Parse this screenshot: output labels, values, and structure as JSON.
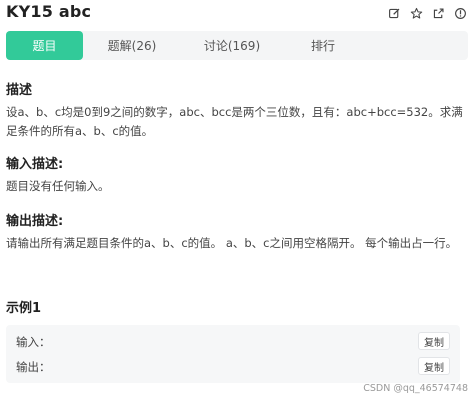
{
  "header": {
    "title": "KY15  abc",
    "icons": [
      "edit-icon",
      "star-icon",
      "share-icon",
      "report-icon"
    ]
  },
  "tabs": [
    {
      "label": "题目",
      "active": true
    },
    {
      "label": "题解(26)",
      "active": false
    },
    {
      "label": "讨论(169)",
      "active": false
    },
    {
      "label": "排行",
      "active": false
    }
  ],
  "description": {
    "heading": "描述",
    "text": "设a、b、c均是0到9之间的数字，abc、bcc是两个三位数，且有：abc+bcc=532。求满足条件的所有a、b、c的值。"
  },
  "input_desc": {
    "heading": "输入描述:",
    "text": "题目没有任何输入。"
  },
  "output_desc": {
    "heading": "输出描述:",
    "text": "请输出所有满足题目条件的a、b、c的值。 a、b、c之间用空格隔开。 每个输出占一行。"
  },
  "example": {
    "heading": "示例1",
    "input_label": "输入：",
    "output_label": "输出：",
    "copy_label": "复制"
  },
  "watermark": "CSDN @qq_46574748",
  "colors": {
    "accent": "#32ca99",
    "tab_bg": "#f4f5f6",
    "sample_bg": "#f6f7f8"
  }
}
